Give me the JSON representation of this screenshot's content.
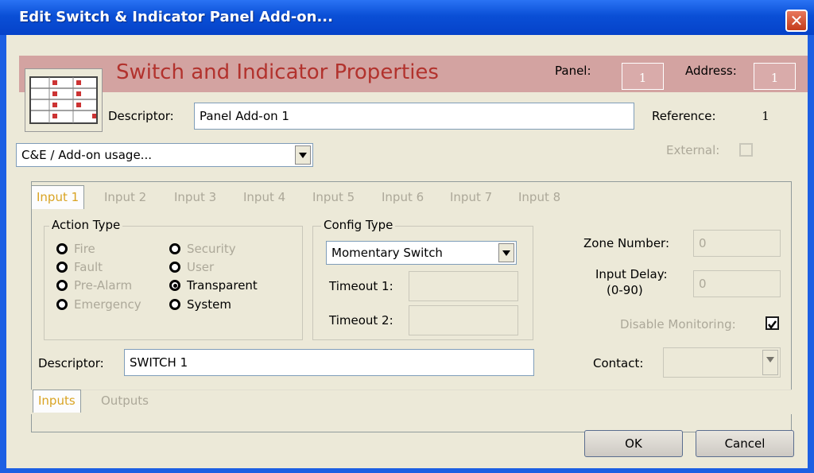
{
  "window": {
    "title": "Edit Switch & Indicator Panel Add-on...",
    "close_glyph": "✕"
  },
  "banner": {
    "title": "Switch and Indicator Properties",
    "panel_label": "Panel:",
    "panel_value": "1",
    "address_label": "Address:",
    "address_value": "1",
    "color": "#d3a3a1"
  },
  "descriptor": {
    "label": "Descriptor:",
    "value": "Panel Add-on 1"
  },
  "reference": {
    "label": "Reference:",
    "value": "1"
  },
  "usage_select": {
    "value": "C&E / Add-on usage..."
  },
  "external": {
    "label": "External:",
    "checked": false
  },
  "input_tabs": [
    "Input 1",
    "Input 2",
    "Input 3",
    "Input 4",
    "Input 5",
    "Input 6",
    "Input 7",
    "Input 8"
  ],
  "action_type": {
    "label": "Action Type",
    "options": [
      "Fire",
      "Fault",
      "Pre-Alarm",
      "Emergency",
      "Security",
      "User",
      "Transparent",
      "System"
    ],
    "selected": "Transparent"
  },
  "config_type": {
    "label": "Config Type",
    "value": "Momentary Switch",
    "timeout1_label": "Timeout 1:",
    "timeout1_value": "",
    "timeout2_label": "Timeout 2:",
    "timeout2_value": ""
  },
  "zone_number": {
    "label": "Zone Number:",
    "value": "0"
  },
  "input_delay": {
    "label_line1": "Input Delay:",
    "label_line2": "(0-90)",
    "value": "0"
  },
  "disable_monitoring": {
    "label": "Disable Monitoring:",
    "checked": true
  },
  "input_descriptor": {
    "label": "Descriptor:",
    "value": "SWITCH 1"
  },
  "contact": {
    "label": "Contact:",
    "value": ""
  },
  "bottom_tabs": [
    "Inputs",
    "Outputs"
  ],
  "buttons": {
    "ok": "OK",
    "cancel": "Cancel"
  }
}
